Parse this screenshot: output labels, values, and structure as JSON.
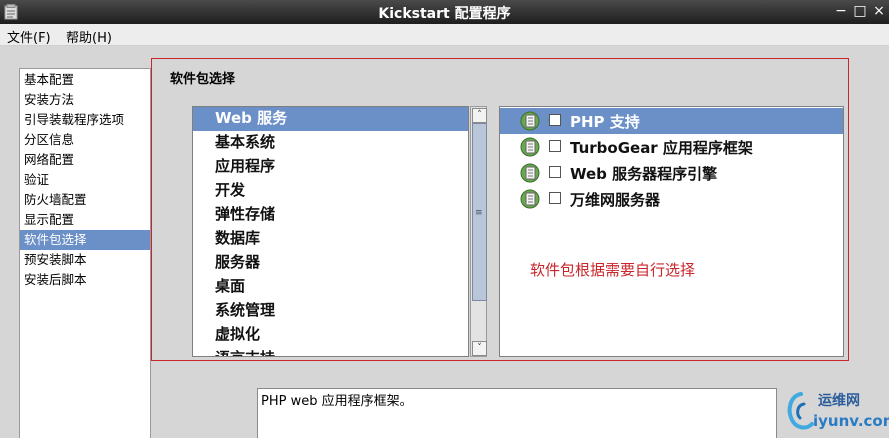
{
  "window": {
    "title": "Kickstart 配置程序",
    "minimize_glyph": "−",
    "maximize_glyph": "□",
    "close_glyph": "×"
  },
  "menu": {
    "file": "文件(F)",
    "help": "帮助(H)"
  },
  "sidebar": {
    "items": [
      {
        "label": "基本配置"
      },
      {
        "label": "安装方法"
      },
      {
        "label": "引导装载程序选项"
      },
      {
        "label": "分区信息"
      },
      {
        "label": "网络配置"
      },
      {
        "label": "验证"
      },
      {
        "label": "防火墙配置"
      },
      {
        "label": "显示配置"
      },
      {
        "label": "软件包选择",
        "selected": true
      },
      {
        "label": "预安装脚本"
      },
      {
        "label": "安装后脚本"
      }
    ]
  },
  "package_panel": {
    "title": "软件包选择",
    "groups": [
      {
        "label": "Web 服务",
        "selected": true
      },
      {
        "label": "基本系统"
      },
      {
        "label": "应用程序"
      },
      {
        "label": "开发"
      },
      {
        "label": "弹性存储"
      },
      {
        "label": "数据库"
      },
      {
        "label": "服务器"
      },
      {
        "label": "桌面"
      },
      {
        "label": "系统管理"
      },
      {
        "label": "虚拟化"
      },
      {
        "label": "语言支持"
      }
    ],
    "scrollbar": {
      "up_glyph": "˄",
      "down_glyph": "˅",
      "grip_glyph": "≡"
    },
    "packages": [
      {
        "label": "PHP 支持",
        "selected": true,
        "checked": false
      },
      {
        "label": "TurboGear 应用程序框架",
        "checked": false
      },
      {
        "label": "Web 服务器程序引擎",
        "checked": false
      },
      {
        "label": "万维网服务器",
        "checked": false
      }
    ],
    "annotation": "软件包根据需要自行选择",
    "description": "PHP web 应用程序框架。"
  },
  "watermark": {
    "line1": "运维网",
    "line2": "iyunv.com"
  },
  "colors": {
    "selection": "#6b8fc7",
    "panel_border": "#c9252a",
    "annotation": "#c9252a"
  }
}
